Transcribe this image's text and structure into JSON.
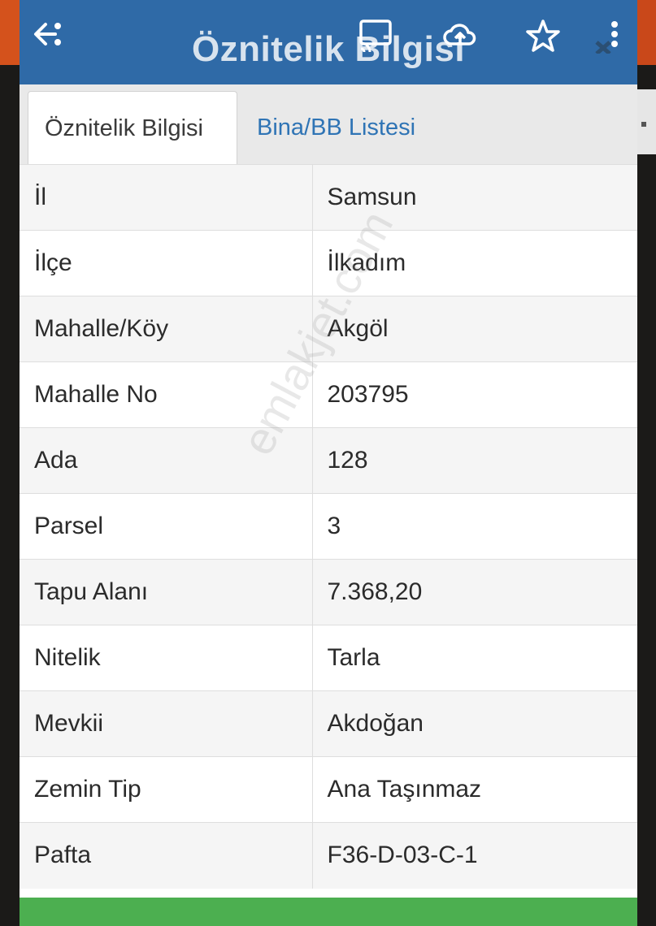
{
  "header": {
    "title": "Öznitelik Bilgisi",
    "background": "#2f6aa7",
    "icons": [
      "back-icon",
      "cast-icon",
      "cloud-upload-icon",
      "star-icon",
      "more-vert-icon"
    ]
  },
  "tabs": [
    {
      "label": "Öznitelik Bilgisi",
      "active": true
    },
    {
      "label": "Bina/BB Listesi",
      "active": false
    }
  ],
  "rows": [
    {
      "key": "İl",
      "value": "Samsun"
    },
    {
      "key": "İlçe",
      "value": "İlkadım"
    },
    {
      "key": "Mahalle/Köy",
      "value": "Akgöl"
    },
    {
      "key": "Mahalle No",
      "value": "203795"
    },
    {
      "key": "Ada",
      "value": "128"
    },
    {
      "key": "Parsel",
      "value": "3"
    },
    {
      "key": "Tapu Alanı",
      "value": "7.368,20"
    },
    {
      "key": "Nitelik",
      "value": "Tarla"
    },
    {
      "key": "Mevkii",
      "value": "Akdoğan"
    },
    {
      "key": "Zemin Tip",
      "value": "Ana Taşınmaz"
    },
    {
      "key": "Pafta",
      "value": "F36-D-03-C-1"
    }
  ],
  "watermark": "emlakjet.com",
  "colors": {
    "accent": "#2f6aa7",
    "tab_link": "#2f74b5",
    "bottom_bar": "#4caf50"
  }
}
